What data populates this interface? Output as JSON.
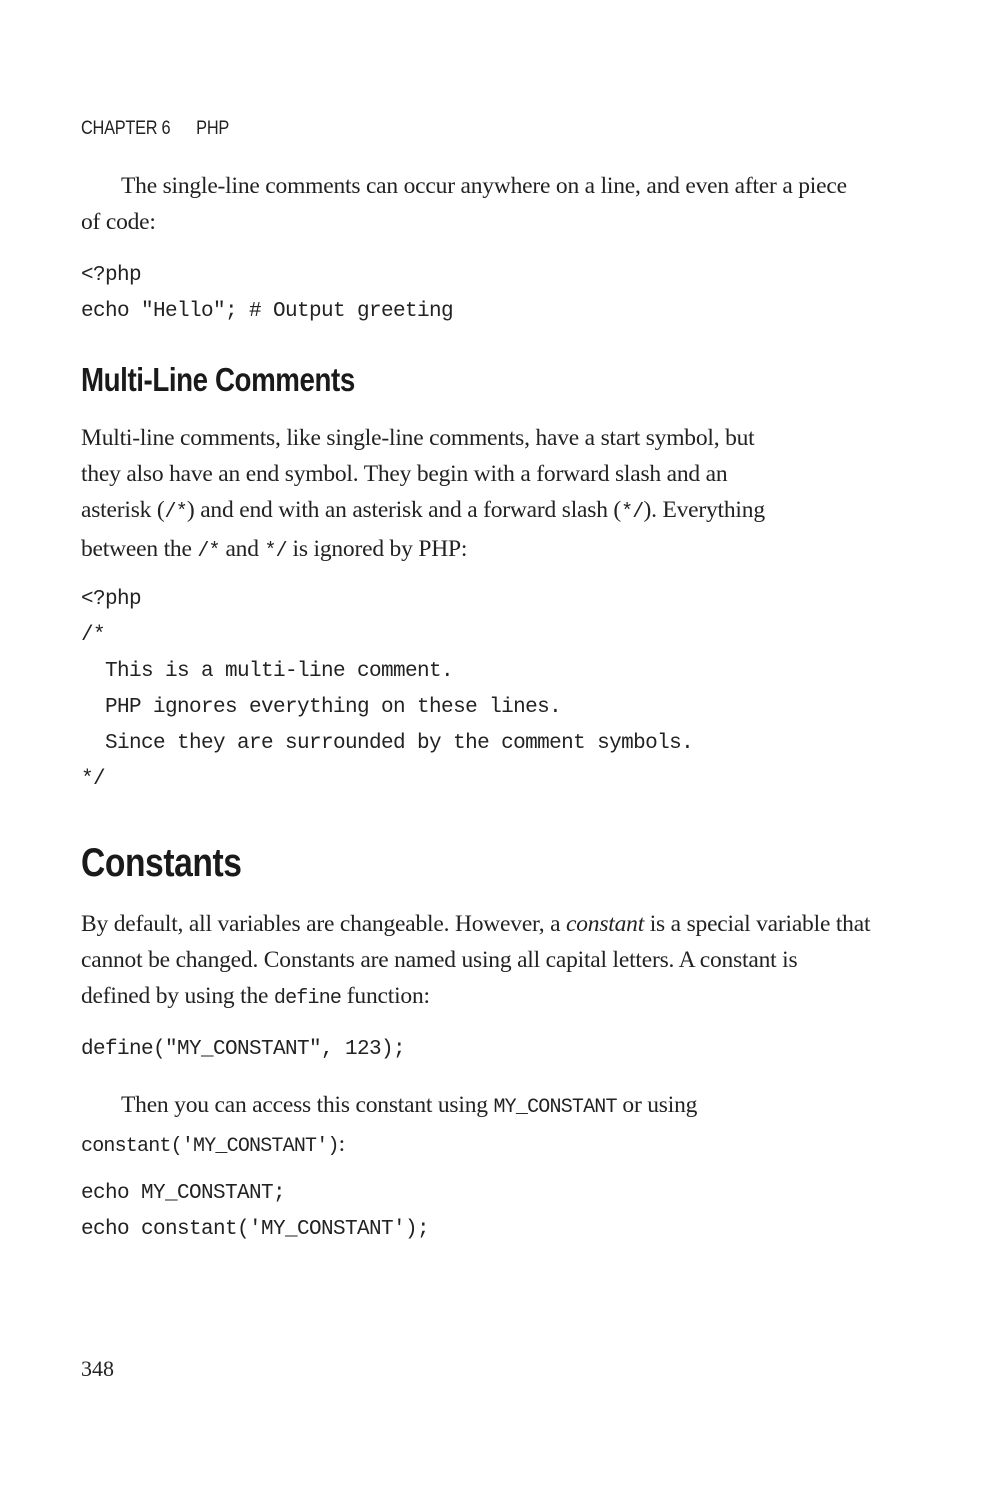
{
  "running_head": {
    "chapter": "CHAPTER 6",
    "title": "PHP"
  },
  "para1": "The single-line comments can occur anywhere on a line, and even after a piece of code:",
  "code1": [
    "<?php",
    "echo \"Hello\"; # Output greeting"
  ],
  "section_multiline": {
    "heading": "Multi-Line Comments",
    "para": {
      "line1": "Multi-line comments, like single-line comments, have a start symbol, but",
      "line2": "they also have an end symbol. They begin with a forward slash and an",
      "line3_a": "asterisk (",
      "line3_code1": "/*",
      "line3_b": ") and end with an asterisk and a forward slash (",
      "line3_code2": "*/",
      "line3_c": "). Everything",
      "line4_a": "between the ",
      "line4_code1": "/*",
      "line4_b": " and ",
      "line4_code2": "*/",
      "line4_c": " is ignored by PHP:"
    },
    "code": [
      "<?php",
      "/*",
      "  This is a multi-line comment.",
      "  PHP ignores everything on these lines.",
      "  Since they are surrounded by the comment symbols.",
      "*/"
    ]
  },
  "section_constants": {
    "heading": "Constants",
    "para": {
      "a": "By default, all variables are changeable. However, a ",
      "em": "constant",
      "b": " is a special variable that cannot be changed. Constants are named using all capital letters. A constant is defined by using the ",
      "code": "define",
      "c": " function:"
    },
    "code1": "define(\"MY_CONSTANT\", 123);",
    "para2": {
      "a": "Then you can access this constant using ",
      "code1": "MY_CONSTANT",
      "b": " or using ",
      "code2": "constant('MY_CONSTANT')",
      "c": ":"
    },
    "code2": [
      "echo MY_CONSTANT;",
      "echo constant('MY_CONSTANT');"
    ]
  },
  "page_number": "348"
}
